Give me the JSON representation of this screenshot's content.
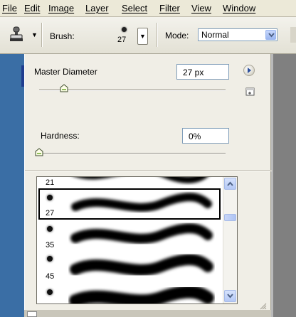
{
  "menu": [
    "File",
    "Edit",
    "Image",
    "Layer",
    "Select",
    "Filter",
    "View",
    "Window"
  ],
  "options_bar": {
    "tool_icon": "clone-stamp-icon",
    "brush_label": "Brush:",
    "brush_size": "27",
    "mode_label": "Mode:",
    "mode_value": "Normal"
  },
  "brush_panel": {
    "master_diameter_label": "Master Diameter",
    "master_diameter_value": "27 px",
    "master_diameter_slider_fraction": 0.15,
    "hardness_label": "Hardness:",
    "hardness_value": "0%",
    "hardness_slider_fraction": 0.0,
    "menu_icon": "arrow-circle-icon",
    "new_preset_icon": "new-preset-icon",
    "presets": [
      {
        "size": "21"
      },
      {
        "size": "27",
        "selected": true
      },
      {
        "size": "35"
      },
      {
        "size": "45"
      },
      {
        "size": ""
      }
    ]
  },
  "colors": {
    "desktop_blue": "#3a6ea5",
    "panel_bg": "#f0eee6",
    "scroll_blue": "#b4c8f5"
  }
}
